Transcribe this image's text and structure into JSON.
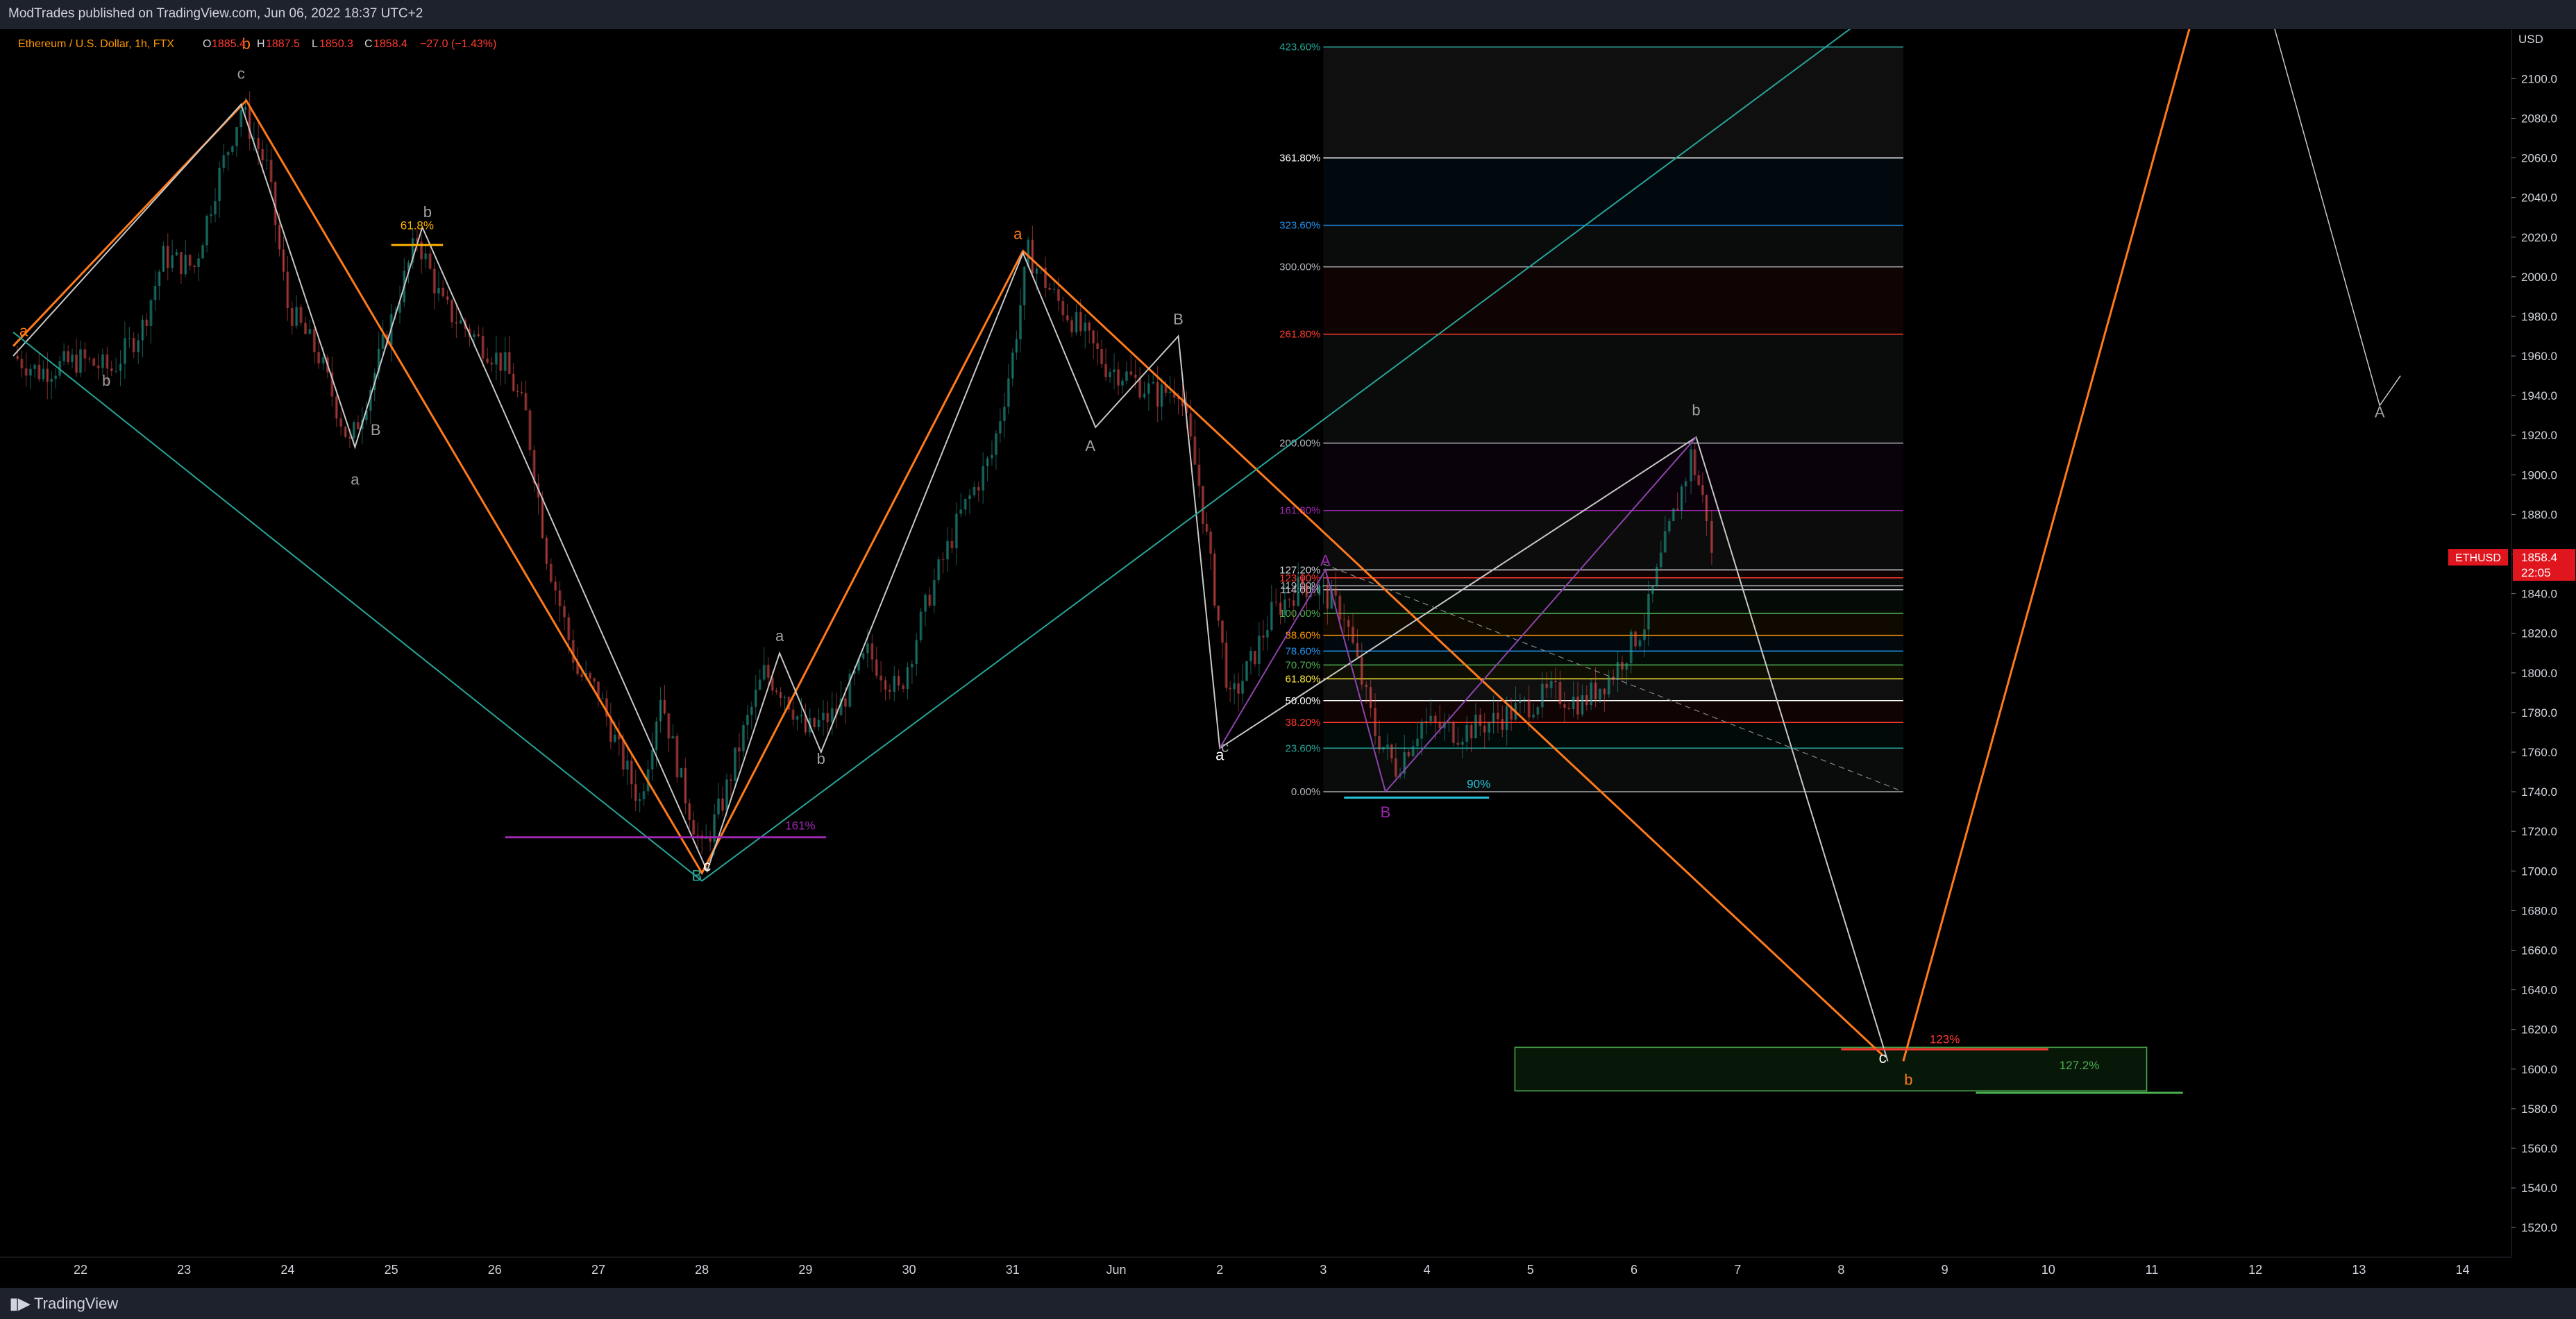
{
  "header": {
    "published_by": "ModTrades published on TradingView.com, Jun 06, 2022 18:37 UTC+2"
  },
  "footer": {
    "brand": "TradingView"
  },
  "chart_data": {
    "type": "candlestick",
    "title": "Ethereum / U.S. Dollar, 1h, FTX",
    "ohlc": {
      "O": {
        "label": "O",
        "value": "1885.4"
      },
      "H": {
        "label": "H",
        "value": "1887.5"
      },
      "L": {
        "label": "L",
        "value": "1850.3"
      },
      "C": {
        "label": "C",
        "value": "1858.4"
      },
      "chg": "−27.0 (−1.43%)"
    },
    "currency": "USD",
    "symbol": "ETHUSD",
    "last_price": "1858.4",
    "countdown": "22:05",
    "ylim": [
      1505,
      2125
    ],
    "y_ticks": [
      1520,
      1540,
      1560,
      1580,
      1600,
      1620,
      1640,
      1660,
      1680,
      1700,
      1720,
      1740,
      1760,
      1780,
      1800,
      1820,
      1840,
      1860,
      1880,
      1900,
      1920,
      1940,
      1960,
      1980,
      2000,
      2020,
      2040,
      2060,
      2080,
      2100
    ],
    "x_ticks": [
      {
        "label": "22",
        "day": 22
      },
      {
        "label": "23",
        "day": 23
      },
      {
        "label": "24",
        "day": 24
      },
      {
        "label": "25",
        "day": 25
      },
      {
        "label": "26",
        "day": 26
      },
      {
        "label": "27",
        "day": 27
      },
      {
        "label": "28",
        "day": 28
      },
      {
        "label": "29",
        "day": 29
      },
      {
        "label": "30",
        "day": 30
      },
      {
        "label": "31",
        "day": 31
      },
      {
        "label": "Jun",
        "day": 32
      },
      {
        "label": "2",
        "day": 33
      },
      {
        "label": "3",
        "day": 34
      },
      {
        "label": "4",
        "day": 35
      },
      {
        "label": "5",
        "day": 36
      },
      {
        "label": "6",
        "day": 37
      },
      {
        "label": "7",
        "day": 38
      },
      {
        "label": "8",
        "day": 39
      },
      {
        "label": "9",
        "day": 40
      },
      {
        "label": "10",
        "day": 41
      },
      {
        "label": "11",
        "day": 42
      },
      {
        "label": "12",
        "day": 43
      },
      {
        "label": "13",
        "day": 44
      },
      {
        "label": "14",
        "day": 45
      }
    ],
    "price_path": [
      [
        21.35,
        1960
      ],
      [
        21.6,
        1952
      ],
      [
        22.0,
        1958
      ],
      [
        22.3,
        1953
      ],
      [
        22.6,
        1975
      ],
      [
        22.8,
        2010
      ],
      [
        23.1,
        2005
      ],
      [
        23.3,
        2045
      ],
      [
        23.55,
        2085
      ],
      [
        23.8,
        2055
      ],
      [
        24.0,
        1985
      ],
      [
        24.3,
        1960
      ],
      [
        24.6,
        1915
      ],
      [
        24.8,
        1945
      ],
      [
        25.0,
        1978
      ],
      [
        25.25,
        2020
      ],
      [
        25.5,
        1985
      ],
      [
        25.8,
        1970
      ],
      [
        26.1,
        1955
      ],
      [
        26.3,
        1930
      ],
      [
        26.5,
        1860
      ],
      [
        26.8,
        1800
      ],
      [
        27.0,
        1790
      ],
      [
        27.2,
        1760
      ],
      [
        27.4,
        1735
      ],
      [
        27.6,
        1790
      ],
      [
        27.8,
        1745
      ],
      [
        28.0,
        1710
      ],
      [
        28.2,
        1735
      ],
      [
        28.4,
        1770
      ],
      [
        28.6,
        1800
      ],
      [
        28.8,
        1790
      ],
      [
        29.0,
        1770
      ],
      [
        29.3,
        1780
      ],
      [
        29.6,
        1810
      ],
      [
        29.9,
        1790
      ],
      [
        30.2,
        1840
      ],
      [
        30.5,
        1880
      ],
      [
        30.8,
        1910
      ],
      [
        31.0,
        1960
      ],
      [
        31.15,
        2012
      ],
      [
        31.4,
        1990
      ],
      [
        31.7,
        1970
      ],
      [
        31.9,
        1955
      ],
      [
        32.1,
        1950
      ],
      [
        32.4,
        1940
      ],
      [
        32.6,
        1945
      ],
      [
        32.8,
        1895
      ],
      [
        32.95,
        1840
      ],
      [
        33.1,
        1785
      ],
      [
        33.3,
        1805
      ],
      [
        33.5,
        1830
      ],
      [
        33.8,
        1845
      ],
      [
        34.0,
        1840
      ],
      [
        34.2,
        1830
      ],
      [
        34.5,
        1770
      ],
      [
        34.7,
        1752
      ],
      [
        34.95,
        1775
      ],
      [
        35.3,
        1770
      ],
      [
        35.6,
        1775
      ],
      [
        35.9,
        1782
      ],
      [
        36.2,
        1790
      ],
      [
        36.5,
        1785
      ],
      [
        36.8,
        1800
      ],
      [
        37.1,
        1825
      ],
      [
        37.3,
        1865
      ],
      [
        37.5,
        1900
      ],
      [
        37.55,
        1910
      ],
      [
        37.7,
        1880
      ],
      [
        37.75,
        1858
      ]
    ],
    "wave_labels": [
      {
        "text": "a",
        "x": 21.45,
        "y": 1970,
        "color": "#ff7a1a"
      },
      {
        "text": "b",
        "x": 22.25,
        "y": 1945,
        "color": "#a0a0a0"
      },
      {
        "text": "b",
        "x": 23.6,
        "y": 2115,
        "color": "#ff7a1a"
      },
      {
        "text": "c",
        "x": 23.55,
        "y": 2100,
        "color": "#a0a0a0"
      },
      {
        "text": "b",
        "x": 25.35,
        "y": 2030,
        "color": "#a0a0a0"
      },
      {
        "text": "B",
        "x": 24.85,
        "y": 1920,
        "color": "#a0a0a0"
      },
      {
        "text": "a",
        "x": 24.65,
        "y": 1895,
        "color": "#a0a0a0"
      },
      {
        "text": "a",
        "x": 28.75,
        "y": 1816,
        "color": "#a0a0a0"
      },
      {
        "text": "b",
        "x": 29.15,
        "y": 1754,
        "color": "#a0a0a0"
      },
      {
        "text": "c",
        "x": 28.05,
        "y": 1700,
        "color": "#ffffff"
      },
      {
        "text": "B",
        "x": 27.95,
        "y": 1695,
        "color": "#26a69a"
      },
      {
        "text": "a",
        "x": 31.05,
        "y": 2019,
        "color": "#ff7a1a"
      },
      {
        "text": "B",
        "x": 32.6,
        "y": 1976,
        "color": "#a0a0a0"
      },
      {
        "text": "A",
        "x": 31.75,
        "y": 1912,
        "color": "#a0a0a0"
      },
      {
        "text": "a",
        "x": 33.0,
        "y": 1756,
        "color": "#ffffff"
      },
      {
        "text": "c",
        "x": 33.05,
        "y": 1760,
        "color": "#a0a0a0"
      },
      {
        "text": "A",
        "x": 34.02,
        "y": 1854,
        "color": "#9c27b0"
      },
      {
        "text": "B",
        "x": 34.6,
        "y": 1727,
        "color": "#9c27b0"
      },
      {
        "text": "b",
        "x": 37.6,
        "y": 1930,
        "color": "#a0a0a0"
      },
      {
        "text": "c",
        "x": 39.4,
        "y": 1603,
        "color": "#ffffff"
      },
      {
        "text": "b",
        "x": 39.65,
        "y": 1592,
        "color": "#ff7a1a"
      },
      {
        "text": "A",
        "x": 44.2,
        "y": 1929,
        "color": "#a0a0a0"
      }
    ],
    "fib_levels": [
      {
        "label": "0.00%",
        "price": 1740,
        "color": "#b2b5be"
      },
      {
        "label": "23.60%",
        "price": 1762,
        "color": "#26a69a"
      },
      {
        "label": "38.20%",
        "price": 1775,
        "color": "#ff3b30"
      },
      {
        "label": "50.00%",
        "price": 1786,
        "color": "#ffffff"
      },
      {
        "label": "61.80%",
        "price": 1797,
        "color": "#ffeb3b"
      },
      {
        "label": "70.70%",
        "price": 1804,
        "color": "#4caf50"
      },
      {
        "label": "78.60%",
        "price": 1811,
        "color": "#2196f3"
      },
      {
        "label": "88.60%",
        "price": 1819,
        "color": "#ff9800"
      },
      {
        "label": "100.00%",
        "price": 1830,
        "color": "#4caf50"
      },
      {
        "label": "114.00%",
        "price": 1842,
        "color": "#d1d4dc"
      },
      {
        "label": "119.00%",
        "price": 1844,
        "color": "#b2b5be"
      },
      {
        "label": "123.00%",
        "price": 1848,
        "color": "#ff3b30"
      },
      {
        "label": "127.20%",
        "price": 1852,
        "color": "#d1d4dc"
      },
      {
        "label": "161.80%",
        "price": 1882,
        "color": "#9c27b0"
      },
      {
        "label": "200.00%",
        "price": 1916,
        "color": "#b2b5be"
      },
      {
        "label": "261.80%",
        "price": 1971,
        "color": "#ff3b30"
      },
      {
        "label": "300.00%",
        "price": 2005,
        "color": "#b2b5be"
      },
      {
        "label": "323.60%",
        "price": 2026,
        "color": "#2196f3"
      },
      {
        "label": "361.80%",
        "price": 2060,
        "color": "#ffffff"
      },
      {
        "label": "423.60%",
        "price": 2116,
        "color": "#26a69a"
      }
    ],
    "annotations": [
      {
        "text": "61.8%",
        "x": 25.25,
        "y": 2024,
        "color": "#ffb300"
      },
      {
        "text": "161%",
        "x": 28.95,
        "y": 1721,
        "color": "#9c27b0"
      },
      {
        "text": "90%",
        "x": 35.5,
        "y": 1742,
        "color": "#26c6da"
      },
      {
        "text": "123%",
        "x": 40.0,
        "y": 1613,
        "color": "#ff3b30"
      },
      {
        "text": "127.2%",
        "x": 41.3,
        "y": 1600,
        "color": "#4caf50"
      }
    ]
  }
}
